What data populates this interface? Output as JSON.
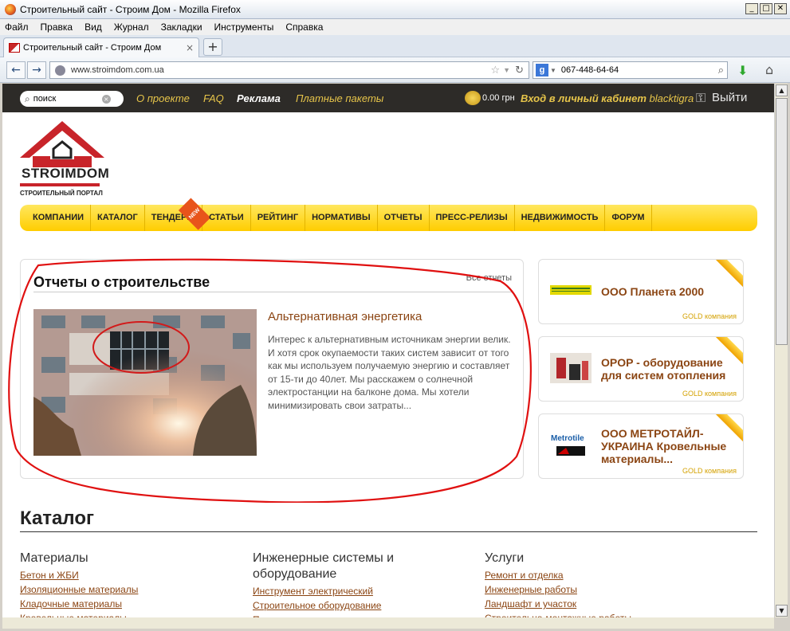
{
  "window": {
    "title": "Строительный сайт - Строим Дом - Mozilla Firefox",
    "min": "_",
    "max": "□",
    "close": "✕"
  },
  "menu": [
    "Файл",
    "Правка",
    "Вид",
    "Журнал",
    "Закладки",
    "Инструменты",
    "Справка"
  ],
  "tab": {
    "label": "Строительный сайт - Строим Дом",
    "close": "×",
    "new": "+"
  },
  "nav": {
    "url": "www.stroimdom.com.ua",
    "search_value": "067-448-64-64",
    "back": "←",
    "forward": "→"
  },
  "site": {
    "search_placeholder": "поиск",
    "toplinks": [
      "О проекте",
      "FAQ",
      "Реклама",
      "Платные пакеты"
    ],
    "balance": "0.00 грн",
    "cabinet": "Вход в личный кабинет",
    "username": "blacktigra",
    "logout": "Выйти",
    "logo_word": "STROIMDOM",
    "logo_sub": "СТРОИТЕЛЬНЫЙ ПОРТАЛ",
    "mainnav": [
      "КОМПАНИИ",
      "КАТАЛОГ",
      "ТЕНДЕРЫ",
      "СТАТЬИ",
      "РЕЙТИНГ",
      "НОРМАТИВЫ",
      "ОТЧЕТЫ",
      "ПРЕСС-РЕЛИЗЫ",
      "НЕДВИЖИМОСТЬ",
      "ФОРУМ"
    ],
    "new_badge": "NEW"
  },
  "reports": {
    "heading": "Отчеты о строительстве",
    "all": "Все отчеты",
    "title": "Альтернативная энергетика",
    "text": "Интерес к альтернативным источникам энергии велик. И хотя срок окупаемости таких систем  зависит от того как мы используем получаемую энергию и составляет от 15-ти до 40лет. Мы расскажем о солнечной электростанции на балконе дома. Мы хотели минимизировать свои затраты..."
  },
  "gold": [
    {
      "name": "ООО Планета 2000",
      "badge": "GOLD компания"
    },
    {
      "name": "OPOP - оборудование для систем отопления",
      "badge": "GOLD компания"
    },
    {
      "name": "ООО МЕТРОТАЙЛ-УКРАИНА Кровельные материалы...",
      "badge": "GOLD компания",
      "logo": "Metrotile"
    }
  ],
  "catalog": {
    "heading": "Каталог",
    "columns": [
      {
        "title": "Материалы",
        "links": [
          "Бетон и ЖБИ",
          "Изоляционные материалы",
          "Кладочные материалы",
          "Кровельные материалы"
        ]
      },
      {
        "title": "Инженерные системы и оборудование",
        "links": [
          "Инструмент электрический",
          "Строительное оборудование",
          "Производственные линии и станки"
        ]
      },
      {
        "title": "Услуги",
        "links": [
          "Ремонт и отделка",
          "Инженерные работы",
          "Ландшафт и участок",
          "Строительно-монтажные работы"
        ]
      }
    ]
  }
}
